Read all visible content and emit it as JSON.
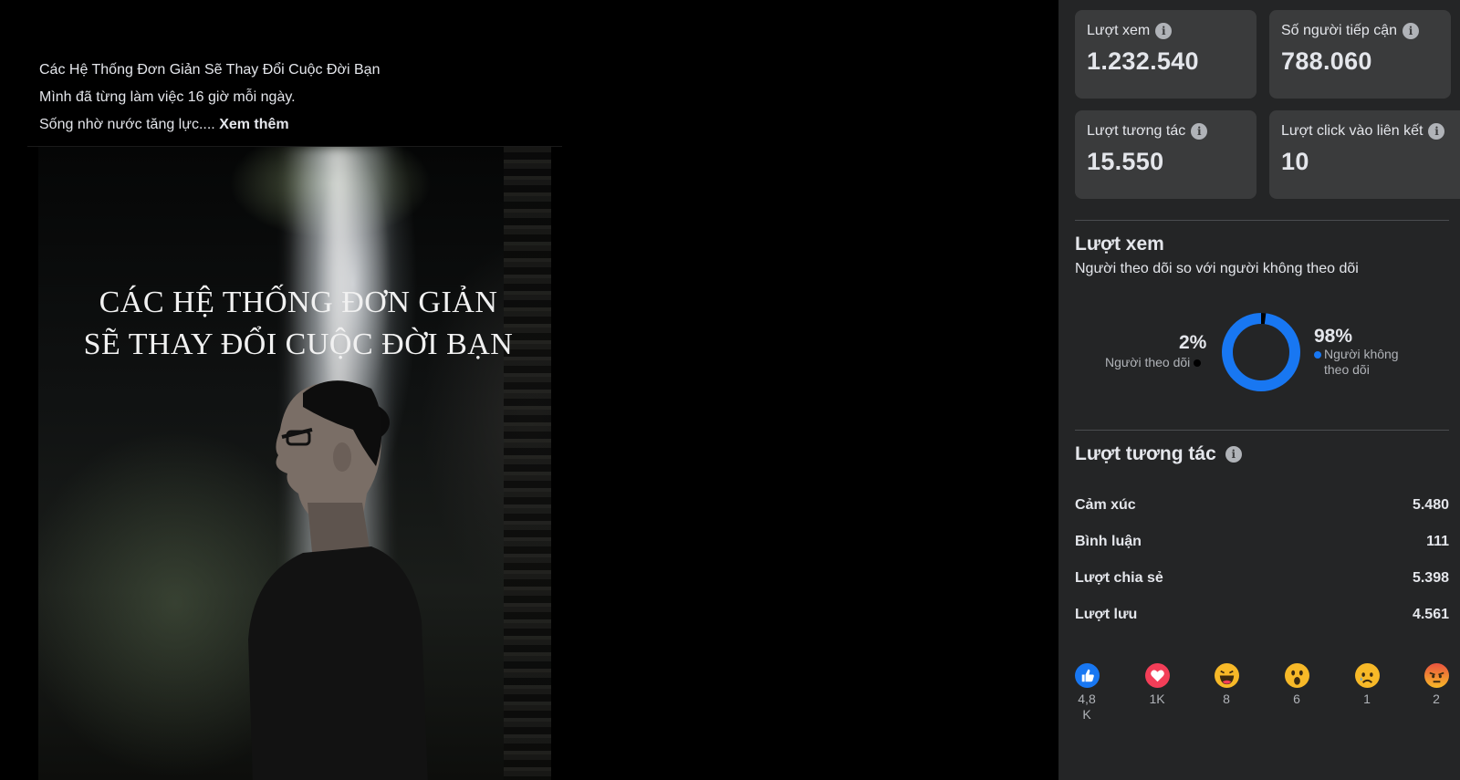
{
  "post": {
    "caption_lines": [
      "Các Hệ Thống Đơn Giản Sẽ Thay Đổi Cuộc Đời Bạn",
      "Mình đã từng làm việc 16 giờ mỗi ngày.",
      "Sống nhờ nước tăng lực...."
    ],
    "see_more": "Xem thêm",
    "image_title_lines": [
      "CÁC HỆ THỐNG ĐƠN GIẢN",
      "SẼ THAY ĐỔI CUỘC ĐỜI BẠN"
    ]
  },
  "stats": [
    {
      "label": "Lượt xem",
      "value": "1.232.540"
    },
    {
      "label": "Số người tiếp cận",
      "value": "788.060"
    },
    {
      "label": "Lượt tương tác",
      "value": "15.550"
    },
    {
      "label": "Lượt click vào liên kết",
      "value": "10"
    }
  ],
  "views_section": {
    "title": "Lượt xem",
    "subtitle": "Người theo dõi so với người không theo dõi",
    "followers_pct": "2%",
    "followers_label": "Người theo dõi",
    "non_followers_pct": "98%",
    "non_followers_label_lines": [
      "Người không",
      "theo dõi"
    ],
    "followers_fraction": 0.02,
    "followers_color": "#000000",
    "non_followers_color": "#1877f2"
  },
  "engagement_section": {
    "title": "Lượt tương tác",
    "rows": [
      {
        "label": "Cảm xúc",
        "value": "5.480"
      },
      {
        "label": "Bình luận",
        "value": "111"
      },
      {
        "label": "Lượt chia sẻ",
        "value": "5.398"
      },
      {
        "label": "Lượt lưu",
        "value": "4.561"
      }
    ]
  },
  "reactions": [
    {
      "icon": "like-icon",
      "count_lines": [
        "4,8",
        "K"
      ]
    },
    {
      "icon": "love-icon",
      "count_lines": [
        "1K"
      ]
    },
    {
      "icon": "haha-icon",
      "count_lines": [
        "8"
      ]
    },
    {
      "icon": "wow-icon",
      "count_lines": [
        "6"
      ]
    },
    {
      "icon": "sad-icon",
      "count_lines": [
        "1"
      ]
    },
    {
      "icon": "angry-icon",
      "count_lines": [
        "2"
      ]
    }
  ],
  "colors": {
    "panel_bg": "#242526",
    "card_bg": "#3a3b3c",
    "accent_blue": "#1877f2"
  }
}
